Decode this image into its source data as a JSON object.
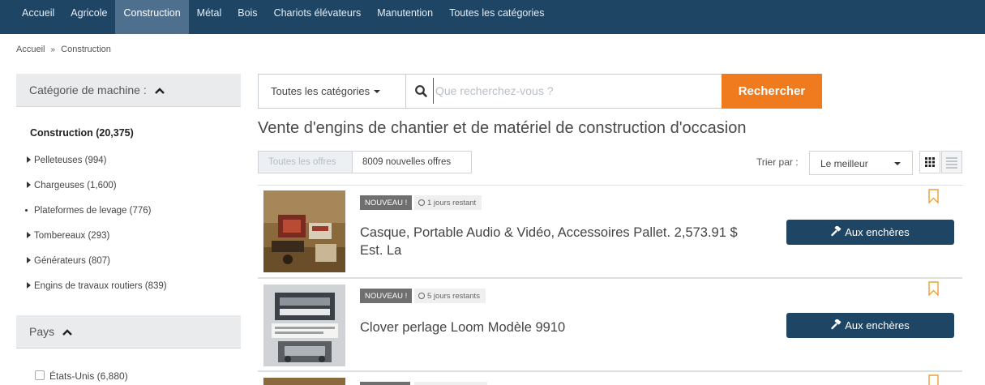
{
  "nav": {
    "items": [
      {
        "label": "Accueil",
        "active": false
      },
      {
        "label": "Agricole",
        "active": false
      },
      {
        "label": "Construction",
        "active": true
      },
      {
        "label": "Métal",
        "active": false
      },
      {
        "label": "Bois",
        "active": false
      },
      {
        "label": "Chariots élévateurs",
        "active": false
      },
      {
        "label": "Manutention",
        "active": false
      },
      {
        "label": "Toutes les catégories",
        "active": false
      }
    ]
  },
  "breadcrumb": {
    "home": "Accueil",
    "separator": "»",
    "current": "Construction"
  },
  "sidebar": {
    "category_header": "Catégorie de machine :",
    "category_title": "Construction (20,375)",
    "categories": [
      {
        "label": "Pelleteuses (994)",
        "marker": "triangle"
      },
      {
        "label": "Chargeuses (1,600)",
        "marker": "triangle"
      },
      {
        "label": "Plateformes de levage (776)",
        "marker": "dot"
      },
      {
        "label": "Tombereaux (293)",
        "marker": "triangle"
      },
      {
        "label": "Générateurs (807)",
        "marker": "triangle"
      },
      {
        "label": "Engins de travaux routiers (839)",
        "marker": "triangle"
      }
    ],
    "country_header": "Pays",
    "countries": [
      {
        "label": "États-Unis (6,880)",
        "checked": false
      }
    ]
  },
  "search": {
    "category_label": "Toutes les catégories",
    "placeholder": "Que recherchez-vous ?",
    "button_label": "Rechercher"
  },
  "page_title": "Vente d'engins de chantier et de matériel de construction d'occasion",
  "filters": {
    "all_label": "Toutes les offres",
    "new_label": "8009 nouvelles offres"
  },
  "sort": {
    "label": "Trier par :",
    "value": "Le meilleur"
  },
  "listings": [
    {
      "badge": "NOUVEAU !",
      "time_left": "1 jours restant",
      "title": "Casque, Portable Audio & Vidéo, Accessoires Pallet. 2,573.91 $ Est. La",
      "bid_label": "Aux enchères"
    },
    {
      "badge": "NOUVEAU !",
      "time_left": "5 jours restants",
      "title": "Clover perlage Loom Modèle 9910",
      "bid_label": "Aux enchères"
    }
  ],
  "colors": {
    "nav_bg": "#1f4565",
    "nav_active": "#4e6f8e",
    "search_button": "#f07a1e",
    "bid_button": "#1f4565",
    "bookmark": "#f0a030"
  }
}
